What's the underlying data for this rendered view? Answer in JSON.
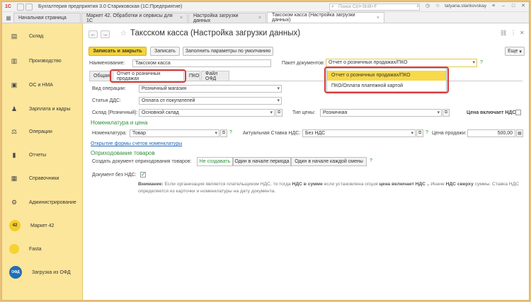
{
  "window": {
    "title": "Бухгалтерия предприятия 3.0 Стариковская  (1С:Предприятие)",
    "search_placeholder": "Поиск Ctrl+Shift+F",
    "user": "tatyana.starikovskay"
  },
  "tabs": [
    {
      "label": "Начальная страница"
    },
    {
      "label": "Маркет 42. Обработки и сервисы для 1С"
    },
    {
      "label": "Настройка загрузки данных"
    },
    {
      "label": "Таксском касса (Настройка загрузки данных)"
    }
  ],
  "sidebar": {
    "items": [
      {
        "label": "Склад",
        "icon": "box-icon"
      },
      {
        "label": "Производство",
        "icon": "factory-icon"
      },
      {
        "label": "ОС и НМА",
        "icon": "assets-icon"
      },
      {
        "label": "Зарплата и кадры",
        "icon": "people-icon"
      },
      {
        "label": "Операции",
        "icon": "operations-icon"
      },
      {
        "label": "Отчеты",
        "icon": "chart-icon"
      },
      {
        "label": "Справочники",
        "icon": "book-icon"
      },
      {
        "label": "Администрирование",
        "icon": "gear-icon"
      },
      {
        "label": "Маркет 42",
        "icon": "market42-icon",
        "badge": "42"
      },
      {
        "label": "Fasta",
        "icon": "fasta-icon"
      },
      {
        "label": "Загрузка из ОФД",
        "icon": "ofd-icon",
        "badge": "ОФД"
      }
    ]
  },
  "header": {
    "page_title": "Таксском касса (Настройка загрузки данных)"
  },
  "toolbar": {
    "save_close": "Записать и закрыть",
    "save": "Записать",
    "fill_defaults": "Заполнить параметры по умолчанию",
    "more": "Еще"
  },
  "form": {
    "name_label": "Наименование:",
    "name_value": "Таксском касса",
    "packet_label": "Пакет документов:",
    "packet_value": "Отчет о розничных продажах/ПКО",
    "tabs": [
      "Общая",
      "Отчет о розничных продажах",
      "ПКО",
      "Файл ОФД"
    ],
    "op_type_label": "Вид операции:",
    "op_type_value": "Розничный магазин",
    "dds_label": "Статья ДДС:",
    "dds_value": "Оплата от покупателей",
    "warehouse_label": "Склад (Розничный):",
    "warehouse_value": "Основной склад",
    "price_type_label": "Тип цены:",
    "price_type_value": "Розничная",
    "price_incl_vat_label": "Цена включает НДС:",
    "section_nomen": "Номенклатура и цена",
    "nomen_label": "Номенклатура:",
    "nomen_value": "Товар",
    "vat_rate_label": "Актуальная Ставка НДС:",
    "vat_rate_value": "Без НДС",
    "price_label": "Цена продажи:",
    "price_value": "500,00",
    "link_accounts": "Открытие формы счетов номенклатуры",
    "section_post": "Оприходование товаров",
    "create_doc_label": "Создать документ оприходования товаров:",
    "seg_options": [
      "Не создавать",
      "Один в начале периода",
      "Один в начале каждой смены"
    ],
    "doc_no_vat_label": "Документ без НДС:",
    "note_prefix": "Внимание:",
    "note_text": "Если организация является плательщиком НДС, то тогда",
    "note_b1": "НДС в сумме",
    "note_mid": "если установлена",
    "note_i": "опция",
    "note_b2": "цена включает НДС ..",
    "note_mid2": "Иначе",
    "note_b3": "НДС сверху",
    "note_end": "суммы. Ставка НДС определяется из карточки и номенклатуры на дату документа."
  },
  "dropdown": {
    "options": [
      "Отчет о розничных продажах/ПКО",
      "ПКО/Оплата платежной картой"
    ]
  },
  "colors": {
    "sidebar_bg": "#fce69b",
    "accent_yellow": "#f5d43a",
    "highlight_red": "#d83b3b",
    "section_green": "#2f8f3a"
  }
}
